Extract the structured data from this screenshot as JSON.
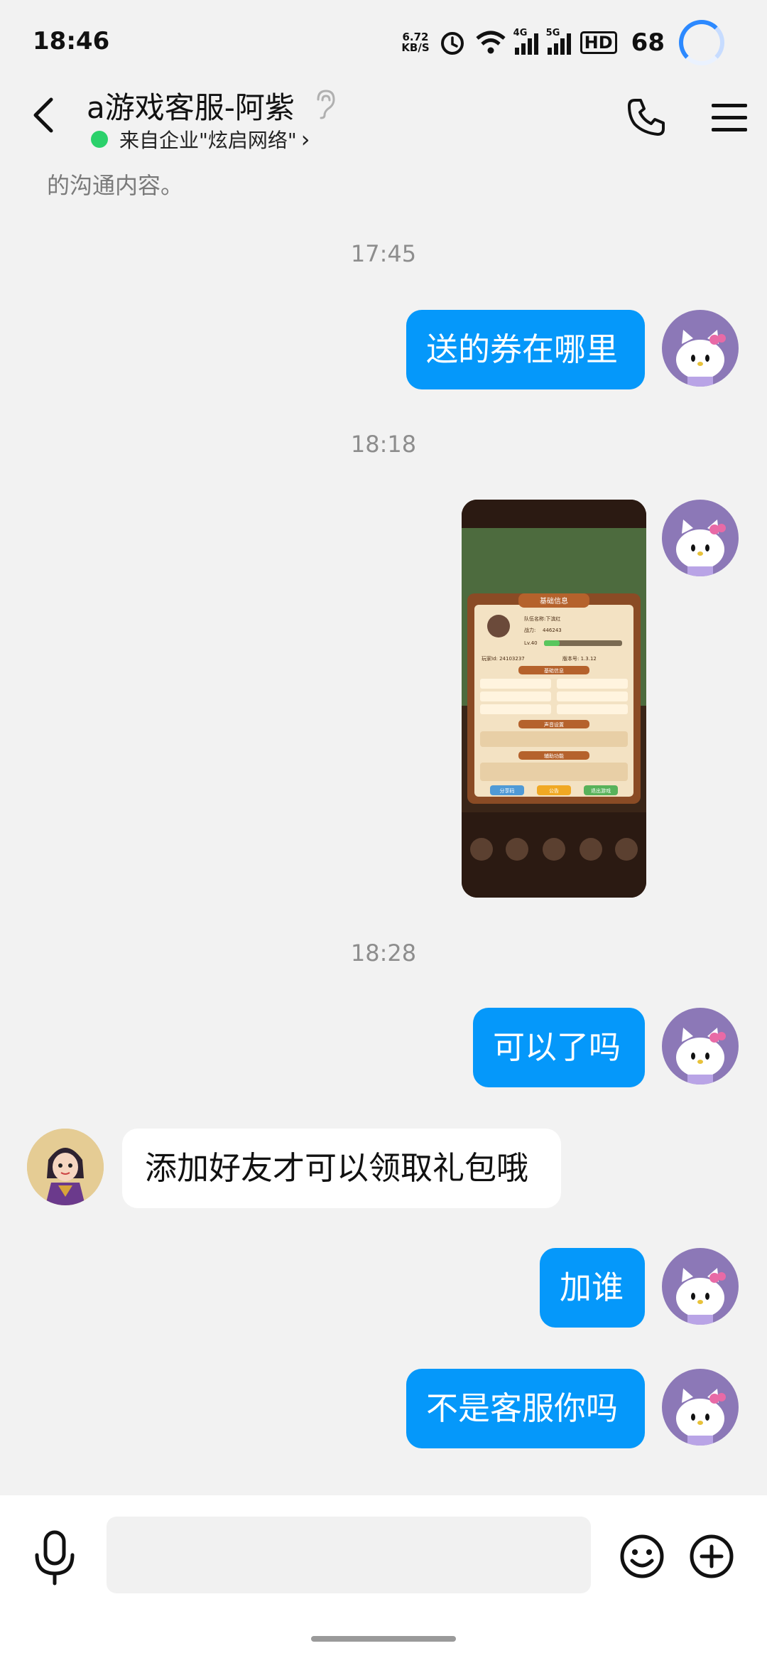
{
  "status_bar": {
    "time": "18:46",
    "net_speed_value": "6.72",
    "net_speed_unit": "KB/S",
    "network_4g": "4G",
    "network_5g": "5G",
    "hd_label": "HD",
    "battery": "68"
  },
  "header": {
    "title": "a游戏客服-阿紫",
    "enterprise": "来自企业\"炫启网络\"",
    "enterprise_chevron": "›"
  },
  "messages": {
    "truncated_text": "的沟通内容。",
    "ts1": "17:45",
    "m1": "送的券在哪里",
    "ts2": "18:18",
    "ts3": "18:28",
    "m2": "可以了吗",
    "m3": "添加好友才可以领取礼包哦",
    "m4": "加谁",
    "m5": "不是客服你吗"
  },
  "game_screenshot": {
    "panel_title": "基础信息",
    "player_name_label": "队伍名称:下滨红",
    "power_label": "战力:",
    "power_value": "446243",
    "level": "Lv.40",
    "player_id": "玩家Id: 24103237",
    "version": "版本号: 1.3.12",
    "section_resources": "基础信息",
    "section_sound": "声音设置",
    "section_assist": "辅助功能",
    "btn_share": "分享码",
    "btn_notice": "公告",
    "btn_logout": "退出游戏"
  },
  "input": {
    "placeholder": ""
  },
  "colors": {
    "bubble_out": "#0598fa",
    "bubble_in": "#ffffff",
    "background": "#f2f2f2",
    "online_dot": "#2bd16b"
  },
  "icons": [
    "back-icon",
    "ear-icon",
    "phone-icon",
    "menu-icon",
    "mic-icon",
    "emoji-icon",
    "plus-icon",
    "alarm-icon",
    "wifi-icon",
    "signal-icon",
    "loading-ring-icon"
  ]
}
